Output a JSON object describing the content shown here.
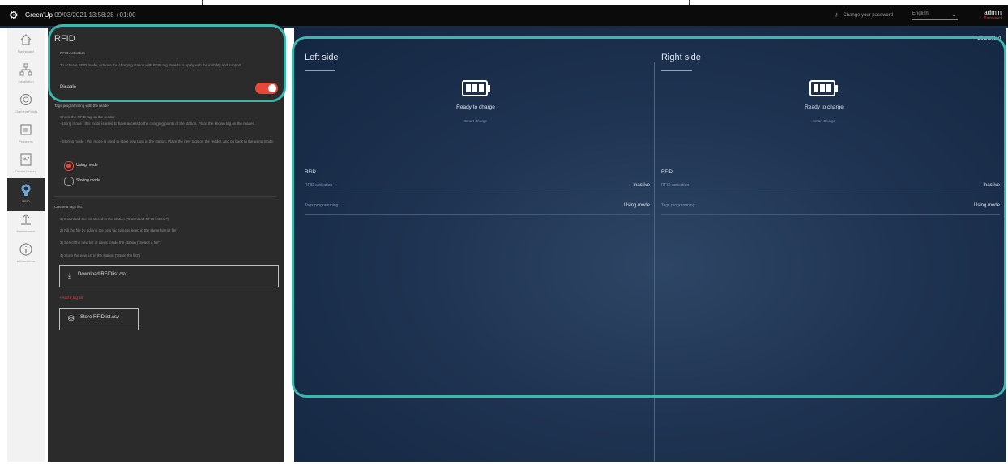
{
  "topbar": {
    "title_prefix": "Green'Up",
    "title_date": " 09/03/2021 13:58:28 +01:00",
    "change_password": "Change your password",
    "language": "English",
    "user_name": "admin",
    "user_role": "Password"
  },
  "nav": [
    {
      "label": "Dashboard",
      "icon": "home-icon"
    },
    {
      "label": "Installation",
      "icon": "network-icon"
    },
    {
      "label": "Charging Points",
      "icon": "charger-icon"
    },
    {
      "label": "Programs",
      "icon": "calendar-icon"
    },
    {
      "label": "Device History",
      "icon": "chart-icon"
    },
    {
      "label": "RFID",
      "icon": "rfid-icon"
    },
    {
      "label": "Maintenance",
      "icon": "upload-icon"
    },
    {
      "label": "Informations",
      "icon": "info-icon"
    }
  ],
  "panel": {
    "title": "RFID",
    "activation_heading": "RFID Activation",
    "activation_desc": "To activate RFID mode, activate the charging station with RFID tag. Needs to apply with the inability and support.",
    "disable_label": "Disable",
    "tags_heading": "Tags programming with the reader",
    "tags_desc_1": "Check the RFID tag on the reader",
    "tags_desc_2": "- Using mode : this mode is used to have access to the charging points of the station. Place the known tag on the reader.",
    "tags_desc_3": "- Storing mode : this mode is used to store new tags in the station. Place the new tags on the reader, and go back to the using mode.",
    "mode_using": "Using mode",
    "mode_storing": "Storing mode",
    "list_heading": "Create a tags list:",
    "steps": [
      "1) Download the list stored in the station (\"Download RFID list.csv\")",
      "2) Fill the file by adding the new tag (please keep in the same format file)",
      "3) Select the new list of cards inside the station (\"Select a file\")",
      "4) Store the new list in the station (\"Store the list\")"
    ],
    "download_label": "Download RFIDlist.csv",
    "add_tag": "+ Add a tag list",
    "store_label": "Store RFIDlist.csv"
  },
  "main": {
    "connected": "Connected",
    "left": {
      "title": "Left side",
      "status": "Ready to charge",
      "substatus": "Smart Charge",
      "rfid_heading": "RFID",
      "rows": [
        {
          "key": "RFID activation",
          "value": "Inactive"
        },
        {
          "key": "Tags programming",
          "value": "Using mode"
        }
      ]
    },
    "right": {
      "title": "Right side",
      "status": "Ready to charge",
      "substatus": "Smart Charge",
      "rfid_heading": "RFID",
      "rows": [
        {
          "key": "RFID activation",
          "value": "Inactive"
        },
        {
          "key": "Tags programming",
          "value": "Using mode"
        }
      ]
    }
  },
  "colors": {
    "accent_red": "#e8483c",
    "highlight_teal": "#3db7ab",
    "main_bg": "#1f3452"
  }
}
